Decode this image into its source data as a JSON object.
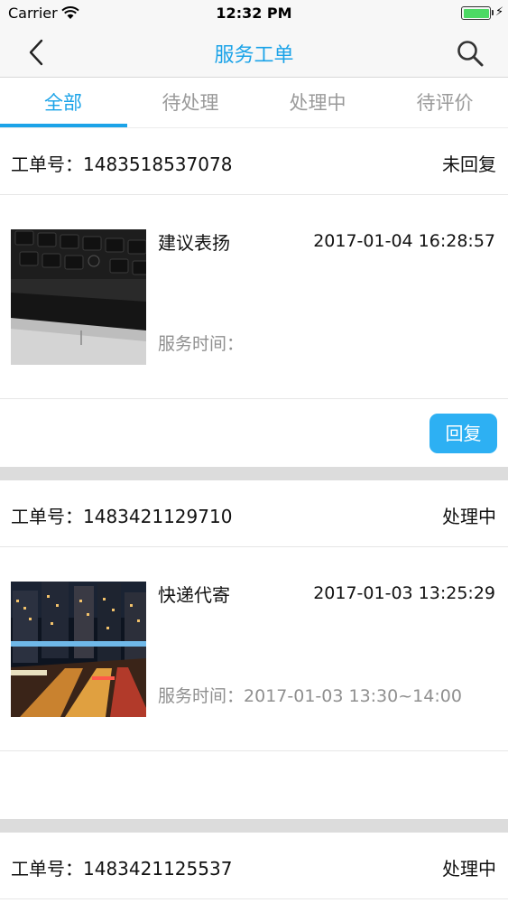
{
  "status_bar": {
    "carrier": "Carrier",
    "time": "12:32 PM",
    "battery_level_percent": 100,
    "battery_color": "#4cd964"
  },
  "nav": {
    "title": "服务工单",
    "back_icon": "chevron-left-icon",
    "search_icon": "search-icon",
    "accent_color": "#1ba3e8"
  },
  "tabs": [
    {
      "label": "全部",
      "active": true
    },
    {
      "label": "待处理",
      "active": false
    },
    {
      "label": "处理中",
      "active": false
    },
    {
      "label": "待评价",
      "active": false
    }
  ],
  "orders": [
    {
      "order_label": "工单号：",
      "order_number": "1483518537078",
      "status": "未回复",
      "title": "建议表扬",
      "datetime": "2017-01-04 16:28:57",
      "service_time_label": "服务时间：",
      "service_time": "",
      "thumbnail": "keyboard-photo",
      "reply_label": "回复"
    },
    {
      "order_label": "工单号：",
      "order_number": "1483421129710",
      "status": "处理中",
      "title": "快递代寄",
      "datetime": "2017-01-03 13:25:29",
      "service_time_label": "服务时间：",
      "service_time": "2017-01-03 13:30~14:00",
      "thumbnail": "city-night-photo"
    },
    {
      "order_label": "工单号：",
      "order_number": "1483421125537",
      "status": "处理中"
    }
  ]
}
